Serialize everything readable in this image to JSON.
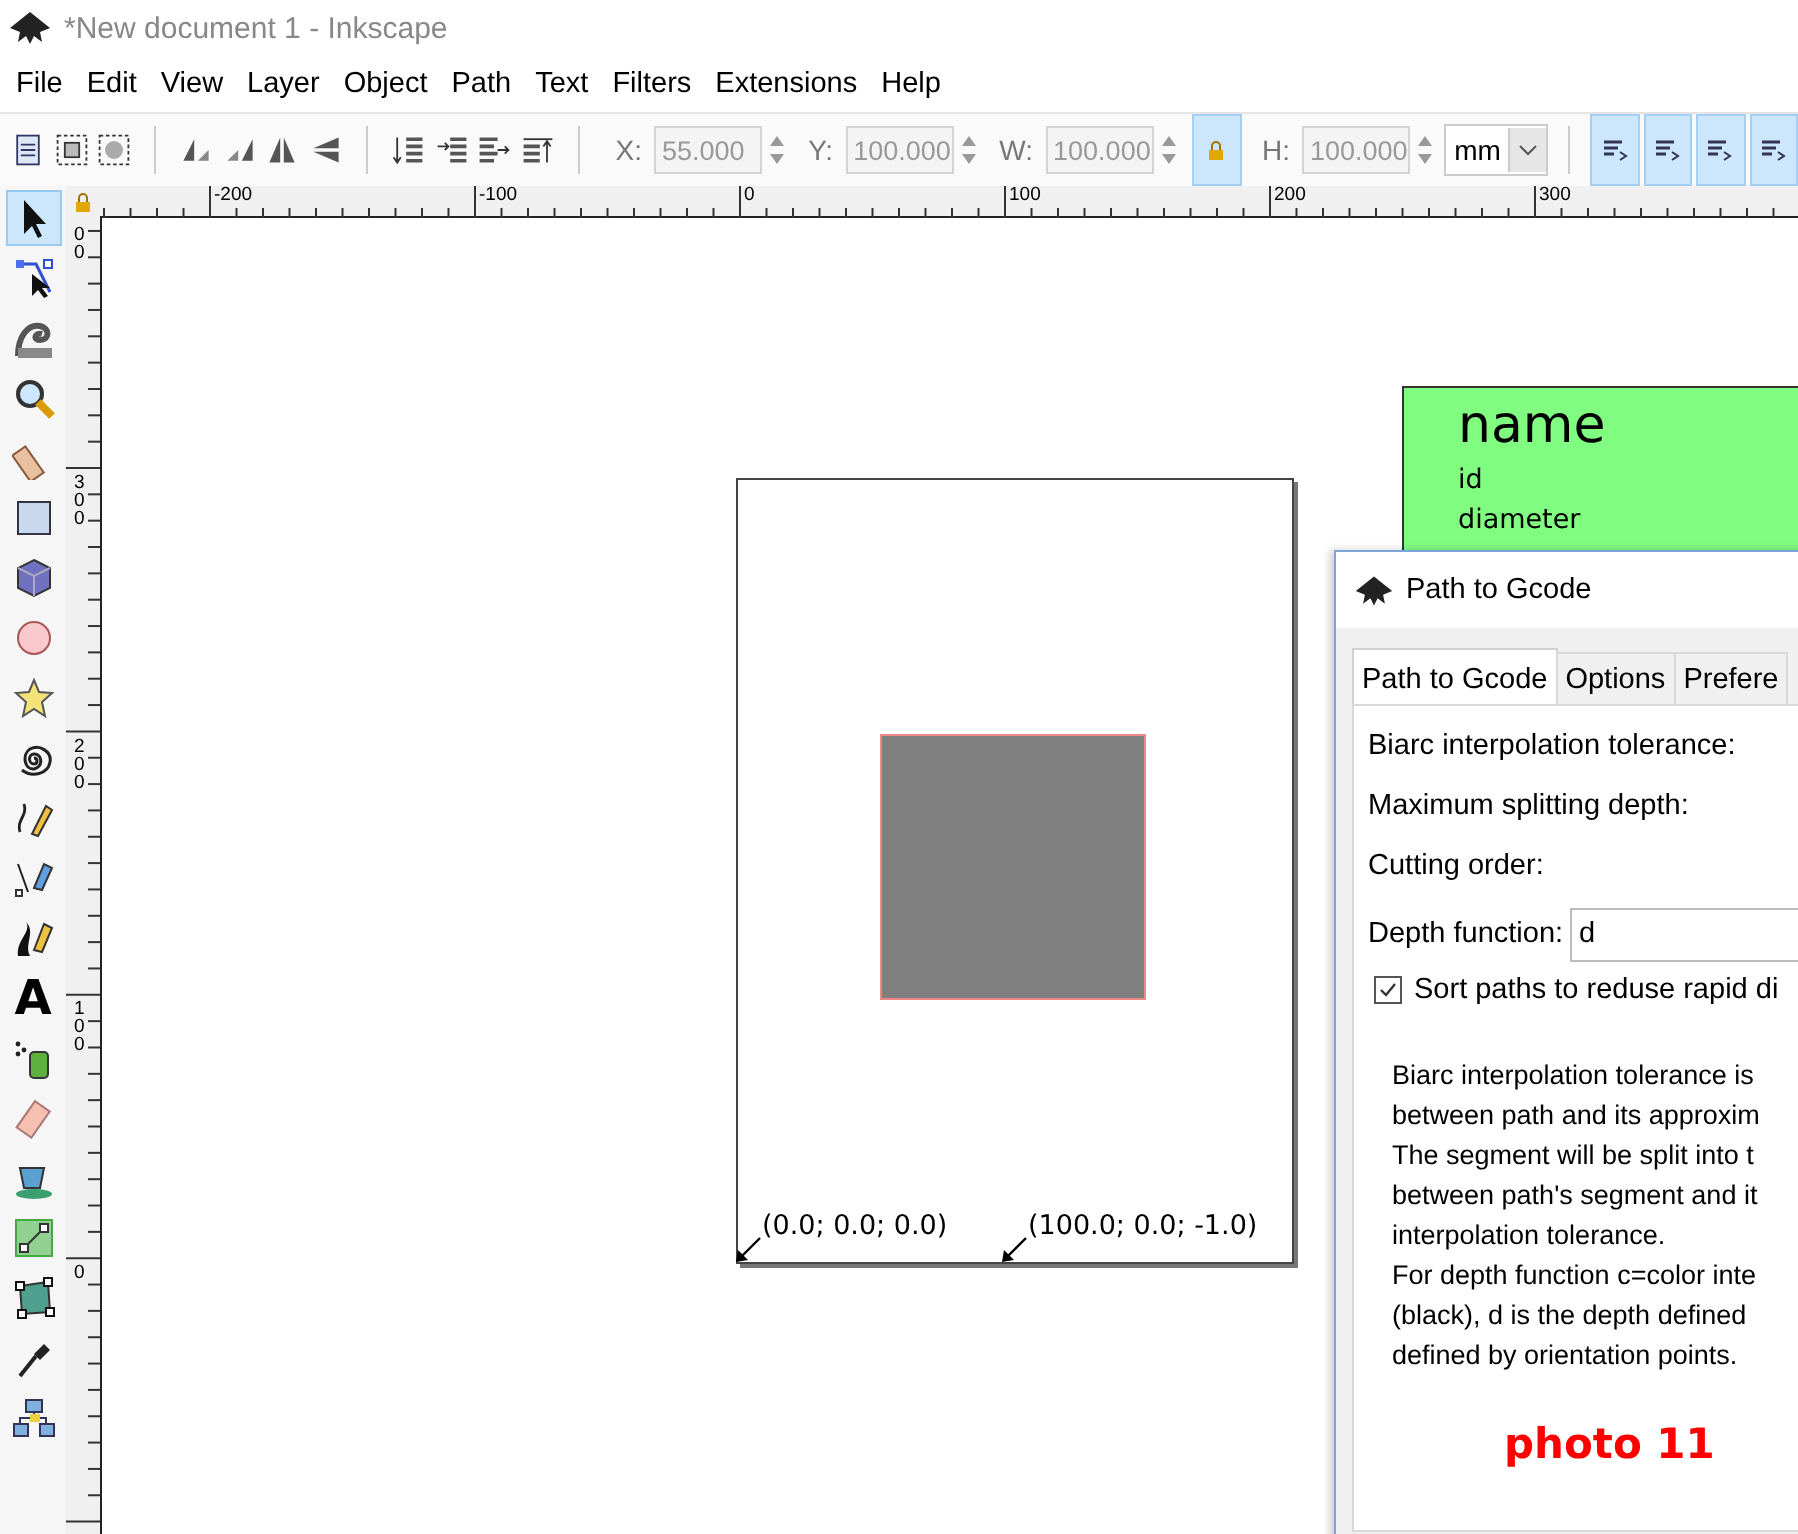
{
  "window": {
    "title": "*New document 1 - Inkscape"
  },
  "menu": [
    "File",
    "Edit",
    "View",
    "Layer",
    "Object",
    "Path",
    "Text",
    "Filters",
    "Extensions",
    "Help"
  ],
  "toolbar": {
    "fields": [
      {
        "label": "X:",
        "value": "55.000",
        "disabled": true
      },
      {
        "label": "Y:",
        "value": "100.000",
        "disabled": true
      },
      {
        "label": "W:",
        "value": "100.000",
        "disabled": true
      },
      {
        "label": "H:",
        "value": "100.000",
        "disabled": true
      }
    ],
    "lock": {
      "on": true
    },
    "unit": "mm",
    "toggles": [
      {
        "on": true
      },
      {
        "on": true
      },
      {
        "on": true
      },
      {
        "on": true
      }
    ]
  },
  "tools": [
    {
      "kind": "select",
      "selected": true
    },
    {
      "kind": "node",
      "selected": false
    },
    {
      "kind": "tweak",
      "selected": false
    },
    {
      "kind": "zoom",
      "selected": false
    },
    {
      "kind": "measure",
      "selected": false
    },
    {
      "kind": "rect",
      "selected": false
    },
    {
      "kind": "box3d",
      "selected": false
    },
    {
      "kind": "ellipse",
      "selected": false
    },
    {
      "kind": "star",
      "selected": false
    },
    {
      "kind": "spiral",
      "selected": false
    },
    {
      "kind": "pencil",
      "selected": false
    },
    {
      "kind": "pen",
      "selected": false
    },
    {
      "kind": "calligraphy",
      "selected": false
    },
    {
      "kind": "text",
      "selected": false,
      "label": "A"
    },
    {
      "kind": "spray",
      "selected": false
    },
    {
      "kind": "eraser",
      "selected": false
    },
    {
      "kind": "bucket",
      "selected": false
    },
    {
      "kind": "gradient",
      "selected": false
    },
    {
      "kind": "mesh",
      "selected": false
    },
    {
      "kind": "dropper",
      "selected": false
    },
    {
      "kind": "connector",
      "selected": false
    }
  ],
  "rulers": {
    "horizontal": [
      "-200",
      "-100",
      "0",
      "100",
      "200",
      "300"
    ],
    "vertical": [
      "00",
      "300",
      "200",
      "100",
      "0"
    ]
  },
  "canvas": {
    "annotations": [
      {
        "text": "(0.0; 0.0; 0.0)"
      },
      {
        "text": "(100.0; 0.0; -1.0)"
      }
    ],
    "object_box": {
      "title": "name",
      "fields": [
        "id",
        "diameter"
      ]
    }
  },
  "dialog": {
    "title": "Path to Gcode",
    "tabs": [
      {
        "label": "Path to Gcode",
        "selected": true
      },
      {
        "label": "Options",
        "selected": false
      },
      {
        "label": "Prefere",
        "selected": false
      }
    ],
    "labels": [
      "Biarc interpolation tolerance:",
      "Maximum splitting depth:",
      "Cutting order:"
    ],
    "depth_function": {
      "label": "Depth function:",
      "value": "d"
    },
    "sort_paths": {
      "label": "Sort paths to reduse rapid di",
      "checked": true
    },
    "description": [
      "Biarc interpolation tolerance is",
      "between path and its approxim",
      "The segment will be split into t",
      "between path's segment and it",
      "interpolation tolerance.",
      "For depth function c=color inte",
      "(black), d is the depth defined",
      "defined by orientation points."
    ],
    "annotation": "photo 11"
  }
}
